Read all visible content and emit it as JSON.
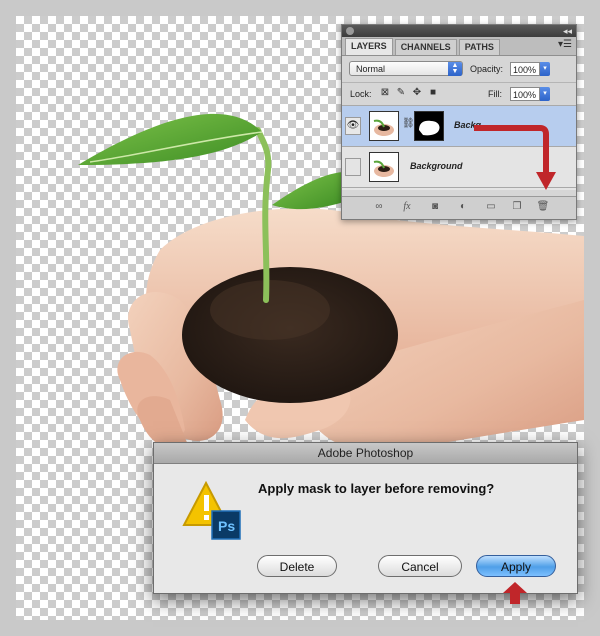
{
  "panel": {
    "tabs": [
      "LAYERS",
      "CHANNELS",
      "PATHS"
    ],
    "blend_mode": "Normal",
    "opacity_label": "Opacity:",
    "opacity_value": "100%",
    "lock_label": "Lock:",
    "fill_label": "Fill:",
    "fill_value": "100%",
    "layers": [
      {
        "name": "Backg",
        "selected": true,
        "visible": true
      },
      {
        "name": "Background",
        "selected": false,
        "visible": false
      }
    ]
  },
  "dialog": {
    "title": "Adobe Photoshop",
    "message": "Apply mask to layer before removing?",
    "app_badge": "Ps",
    "buttons": {
      "delete": "Delete",
      "cancel": "Cancel",
      "apply": "Apply"
    }
  },
  "colors": {
    "accent_red": "#c0262a",
    "selection_blue": "#b7cdee",
    "primary_button": "#4f9fe8"
  },
  "icons": {
    "eye": "eye-icon",
    "link": "chain-link-icon",
    "fx": "fx-icon",
    "mask": "layer-mask-icon",
    "adjustment": "adjustment-layer-icon",
    "group": "folder-icon",
    "new_layer": "new-layer-icon",
    "trash": "trash-icon",
    "warning": "warning-icon"
  }
}
